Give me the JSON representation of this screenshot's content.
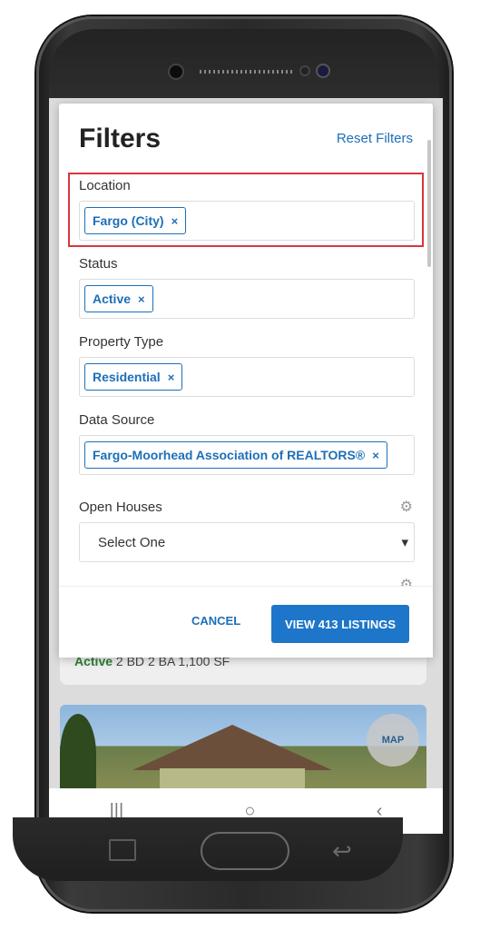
{
  "modal": {
    "title": "Filters",
    "reset_label": "Reset Filters",
    "location": {
      "label": "Location",
      "chip": "Fargo (City)"
    },
    "status": {
      "label": "Status",
      "chip": "Active"
    },
    "property_type": {
      "label": "Property Type",
      "chip": "Residential"
    },
    "data_source": {
      "label": "Data Source",
      "chip": "Fargo-Moorhead Association of REALTORS®"
    },
    "open_houses": {
      "label": "Open Houses",
      "select_value": "Select One"
    },
    "footer": {
      "cancel_label": "CANCEL",
      "view_label": "VIEW 413 LISTINGS"
    },
    "chip_remove": "×"
  },
  "background": {
    "listing": {
      "status": "Active",
      "beds": "2 BD",
      "baths": "2 BA",
      "sqft": "1,100 SF"
    },
    "map_label": "MAP"
  },
  "colors": {
    "accent": "#1d6fb8",
    "button": "#1d76c9",
    "highlight": "#d9363e",
    "active_green": "#2e7d32"
  },
  "icons": {
    "settings": "gear-icon",
    "dropdown": "caret-down-icon",
    "remove": "close-icon"
  }
}
